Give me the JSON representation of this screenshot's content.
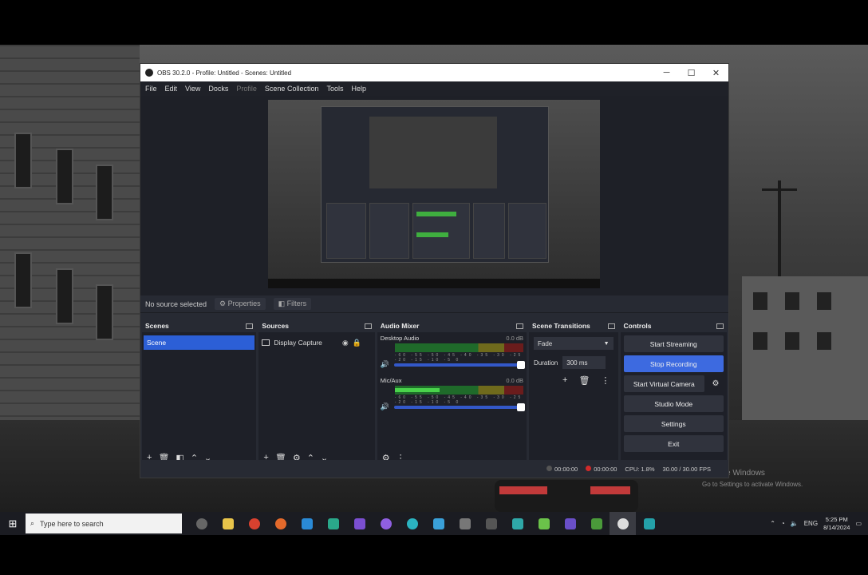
{
  "window": {
    "title": "OBS 30.2.0 - Profile: Untitled - Scenes: Untitled",
    "minimize": "─",
    "maximize": "☐",
    "close": "✕"
  },
  "menu": [
    "File",
    "Edit",
    "View",
    "Docks",
    "Profile",
    "Scene Collection",
    "Tools",
    "Help"
  ],
  "status_row": {
    "no_source": "No source selected",
    "properties": "Properties",
    "filters": "Filters"
  },
  "scenes": {
    "title": "Scenes",
    "items": [
      "Scene"
    ]
  },
  "sources": {
    "title": "Sources",
    "items": [
      {
        "name": "Display Capture"
      }
    ]
  },
  "audio_mixer": {
    "title": "Audio Mixer",
    "channels": [
      {
        "name": "Desktop Audio",
        "db": "0.0 dB",
        "level": 0.0
      },
      {
        "name": "Mic/Aux",
        "db": "0.0 dB",
        "level": 0.35
      }
    ],
    "ticks": "-60 -55 -50 -45 -40 -35 -30 -25 -20 -15 -10 -5 0"
  },
  "scene_transitions": {
    "title": "Scene Transitions",
    "selected": "Fade",
    "duration_label": "Duration",
    "duration_value": "300 ms"
  },
  "controls": {
    "title": "Controls",
    "start_streaming": "Start Streaming",
    "stop_recording": "Stop Recording",
    "start_virtual_camera": "Start Virtual Camera",
    "studio_mode": "Studio Mode",
    "settings": "Settings",
    "exit": "Exit"
  },
  "statusbar": {
    "live": "00:00:00",
    "rec": "00:00:00",
    "cpu": "CPU: 1.8%",
    "fps": "30.00 / 30.00 FPS"
  },
  "watermark": {
    "line1": "Activate Windows",
    "line2": "Go to Settings to activate Windows."
  },
  "taskbar": {
    "search_placeholder": "Type here to search",
    "time": "5:25 PM",
    "date": "8/14/2024",
    "lang": "ENG"
  },
  "colors": {
    "accent": "#3d6ae0",
    "scene_selected": "#2c5fd6",
    "rec": "#d12a2a",
    "meter_green": "#49d24b"
  }
}
